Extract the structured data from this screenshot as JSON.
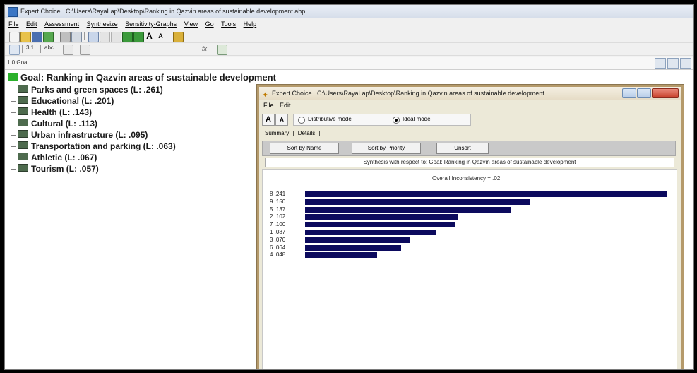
{
  "main_window": {
    "title_app": "Expert Choice",
    "title_path": "C:\\Users\\RayaLap\\Desktop\\Ranking in Qazvin areas of sustainable development.ahp",
    "menu": [
      "File",
      "Edit",
      "Assessment",
      "Synthesize",
      "Sensitivity-Graphs",
      "View",
      "Go",
      "Tools",
      "Help"
    ],
    "toolbar2": {
      "pairwise": "3:1",
      "abc": "abc"
    },
    "path_value": "1.0 Goal"
  },
  "tree": {
    "goal_label": "Goal: Ranking in Qazvin areas of sustainable development",
    "children": [
      {
        "label": "Parks and green spaces (L: .261)"
      },
      {
        "label": "Educational (L: .201)"
      },
      {
        "label": "Health (L: .143)"
      },
      {
        "label": "Cultural (L: .113)"
      },
      {
        "label": "Urban infrastructure (L: .095)"
      },
      {
        "label": "Transportation and parking (L: .063)"
      },
      {
        "label": "Athletic (L: .067)"
      },
      {
        "label": "Tourism (L: .057)"
      }
    ]
  },
  "dialog": {
    "title_app": "Expert Choice",
    "title_path": "C:\\Users\\RayaLap\\Desktop\\Ranking in Qazvin areas of sustainable development...",
    "menu": [
      "File",
      "Edit"
    ],
    "font_up": "A",
    "font_down": "A",
    "mode_distributive": "Distributive mode",
    "mode_ideal": "Ideal mode",
    "selected_mode": "Ideal mode",
    "tab_summary": "Summary",
    "tab_divider": "|",
    "tab_details": "Details",
    "tab_end": "|",
    "btn_sort_name": "Sort by Name",
    "btn_sort_priority": "Sort by Priority",
    "btn_unsort": "Unsort",
    "synthesis_text": "Synthesis with respect to: Goal: Ranking in Qazvin areas of sustainable development",
    "inconsistency": "Overall Inconsistency = .02"
  },
  "chart_data": {
    "type": "bar",
    "orientation": "horizontal",
    "categories": [
      "8",
      "9",
      "5",
      "2",
      "7",
      "1",
      "3",
      "6",
      "4"
    ],
    "value_labels": [
      ".241",
      ".150",
      ".137",
      ".102",
      ".100",
      ".087",
      ".070",
      ".064",
      ".048"
    ],
    "values": [
      0.241,
      0.15,
      0.137,
      0.102,
      0.1,
      0.087,
      0.07,
      0.064,
      0.048
    ],
    "bar_color": "#0c0a5e"
  }
}
